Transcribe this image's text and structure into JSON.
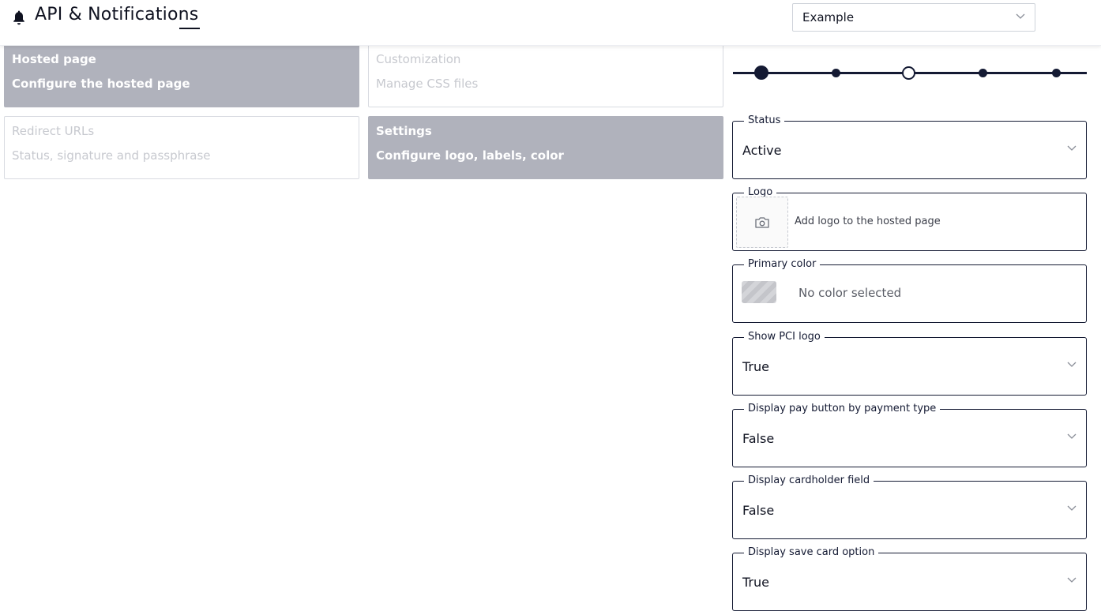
{
  "header": {
    "icon": "bell-icon",
    "title": "API & Notifications",
    "select_value": "Example"
  },
  "cards": [
    {
      "title": "Hosted page",
      "subtitle": "Configure the hosted page",
      "active": true
    },
    {
      "title": "Customization",
      "subtitle": "Manage CSS files",
      "active": false
    },
    {
      "title": "Redirect URLs",
      "subtitle": "Status, signature and passphrase",
      "active": false
    },
    {
      "title": "Settings",
      "subtitle": "Configure logo, labels, color",
      "active": true
    }
  ],
  "stepper": {
    "steps": 5,
    "current": 1,
    "highlighted": 3
  },
  "form": {
    "status": {
      "label": "Status",
      "value": "Active"
    },
    "logo": {
      "label": "Logo",
      "placeholder": "Add logo to the hosted page"
    },
    "primary_color": {
      "label": "Primary color",
      "value": "No color selected"
    },
    "show_pci_logo": {
      "label": "Show PCI logo",
      "value": "True"
    },
    "pay_button": {
      "label": "Display pay button by payment type",
      "value": "False"
    },
    "cardholder": {
      "label": "Display cardholder field",
      "value": "False"
    },
    "save_card": {
      "label": "Display save card option",
      "value": "True"
    }
  },
  "colors": {
    "accent": "#141a33",
    "card_active": "#b0b2bc",
    "card_inactive_text": "#c7c9cf"
  }
}
